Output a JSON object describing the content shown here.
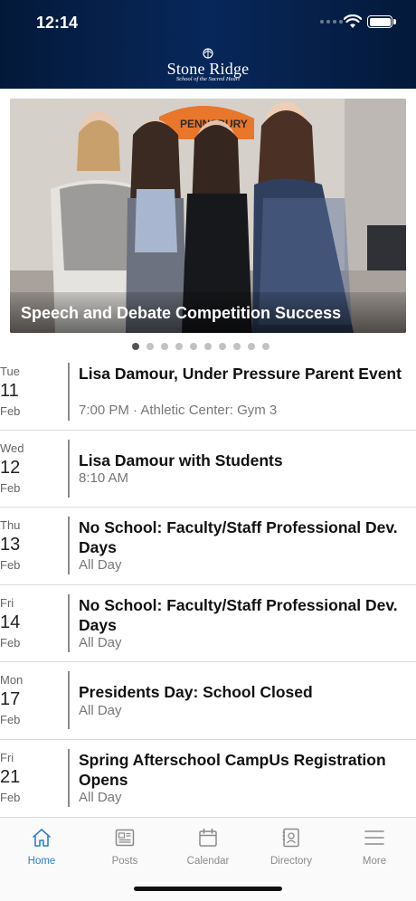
{
  "status": {
    "time": "12:14"
  },
  "brand": {
    "name": "Stone Ridge",
    "subtitle": "School of the Sacred Heart"
  },
  "hero": {
    "caption": "Speech and Debate Competition Success",
    "banner_text": "PENNSBURY",
    "slide_count": 10,
    "active_slide": 1
  },
  "events": [
    {
      "dow": "Tue",
      "day": "11",
      "month": "Feb",
      "title": "Lisa Damour, Under Pressure Parent Event",
      "subtitle": "7:00 PM · Athletic Center: Gym 3"
    },
    {
      "dow": "Wed",
      "day": "12",
      "month": "Feb",
      "title": "Lisa Damour with Students",
      "subtitle": "8:10 AM"
    },
    {
      "dow": "Thu",
      "day": "13",
      "month": "Feb",
      "title": "No School: Faculty/Staff Professional Dev. Days",
      "subtitle": "All Day"
    },
    {
      "dow": "Fri",
      "day": "14",
      "month": "Feb",
      "title": "No School: Faculty/Staff Professional Dev. Days",
      "subtitle": "All Day"
    },
    {
      "dow": "Mon",
      "day": "17",
      "month": "Feb",
      "title": "Presidents Day: School Closed",
      "subtitle": "All Day"
    },
    {
      "dow": "Fri",
      "day": "21",
      "month": "Feb",
      "title": "Spring Afterschool CampUs Registration Opens",
      "subtitle": "All Day"
    }
  ],
  "tabs": [
    {
      "label": "Home",
      "icon": "home-icon",
      "active": true
    },
    {
      "label": "Posts",
      "icon": "posts-icon",
      "active": false
    },
    {
      "label": "Calendar",
      "icon": "calendar-icon",
      "active": false
    },
    {
      "label": "Directory",
      "icon": "directory-icon",
      "active": false
    },
    {
      "label": "More",
      "icon": "menu-icon",
      "active": false
    }
  ],
  "colors": {
    "header": "#07275a",
    "accent": "#2d7dd2",
    "tab_inactive": "#8a8a8a"
  }
}
